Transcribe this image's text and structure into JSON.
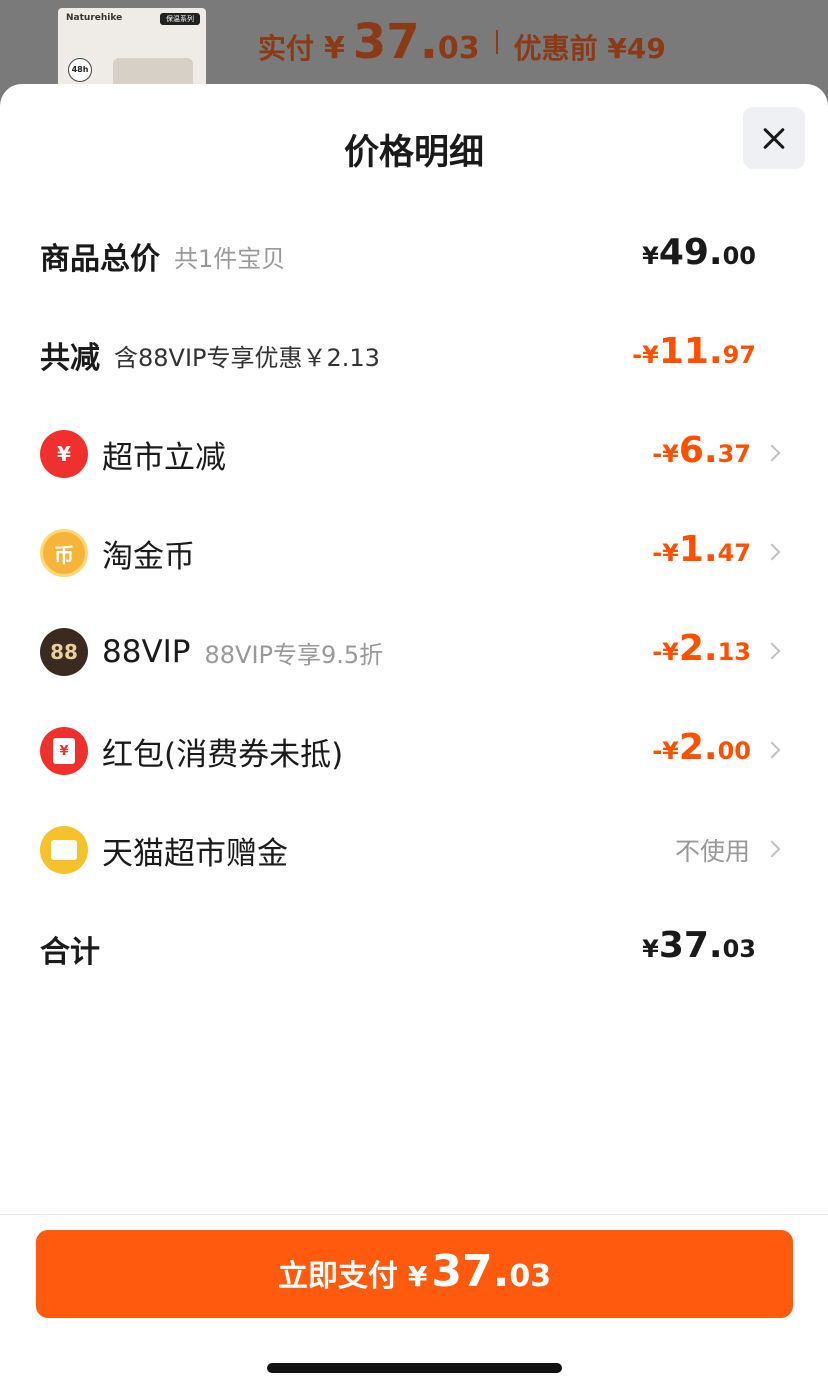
{
  "header": {
    "thumb_brand": "Naturehike",
    "thumb_tag": "保温系列",
    "thumb_badge": "48h",
    "paid_label": "实付",
    "yen": "¥",
    "paid_int": "37.",
    "paid_dec": "03",
    "before_label": "优惠前 ¥49"
  },
  "sheet": {
    "title": "价格明细",
    "close": "close"
  },
  "total_goods": {
    "label": "商品总价",
    "sub": "共1件宝贝",
    "yen": "¥",
    "int": "49.",
    "dec": "00"
  },
  "reduction": {
    "label": "共减",
    "sub": "含88VIP专享优惠￥2.13",
    "yen": "-¥",
    "int": "11.",
    "dec": "97"
  },
  "items": [
    {
      "label": "超市立减",
      "icon": "supermarket-discount-icon",
      "icon_glyph": "¥",
      "yen": "-¥",
      "int": "6.",
      "dec": "37"
    },
    {
      "label": "淘金币",
      "icon": "taojinbi-coin-icon",
      "icon_glyph": "币",
      "yen": "-¥",
      "int": "1.",
      "dec": "47"
    },
    {
      "label": "88VIP",
      "sub": "88VIP专享9.5折",
      "icon": "88vip-icon",
      "icon_glyph": "88",
      "yen": "-¥",
      "int": "2.",
      "dec": "13"
    },
    {
      "label": "红包(消费券未抵)",
      "icon": "red-packet-icon",
      "icon_glyph": "¥",
      "yen": "-¥",
      "int": "2.",
      "dec": "00"
    },
    {
      "label": "天猫超市赠金",
      "icon": "gift-money-icon",
      "value": "不使用"
    }
  ],
  "total": {
    "label": "合计",
    "yen": "¥",
    "int": "37.",
    "dec": "03"
  },
  "pay_button": {
    "label": "立即支付",
    "yen": "¥",
    "int": "37.",
    "dec": "03"
  },
  "colors": {
    "accent": "#ff5000",
    "button": "#ff5a0e"
  }
}
